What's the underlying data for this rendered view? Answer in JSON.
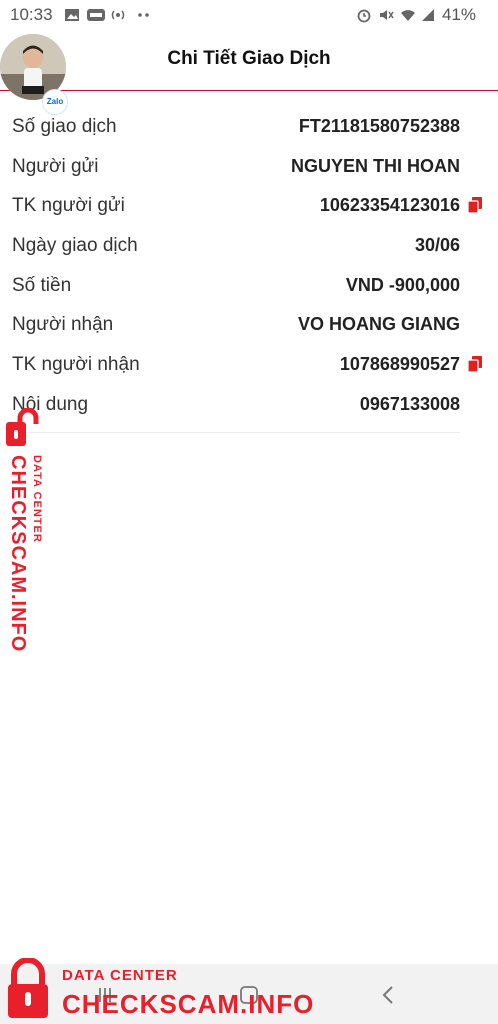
{
  "status_bar": {
    "time": "10:33",
    "battery": "41%",
    "icons": [
      "image-icon",
      "zalo-notification-icon",
      "hotspot-icon",
      "more-dots-icon",
      "alarm-icon",
      "mute-icon",
      "wifi-icon",
      "signal-icon"
    ]
  },
  "header": {
    "title": "Chi Tiết Giao Dịch",
    "avatar_badge": "Zalo"
  },
  "details": [
    {
      "label": "Số giao dịch",
      "value": "FT21181580752388",
      "copy": false
    },
    {
      "label": "Người gửi",
      "value": "NGUYEN THI HOAN",
      "copy": false
    },
    {
      "label": "TK người gửi",
      "value": "10623354123016",
      "copy": true
    },
    {
      "label": "Ngày giao dịch",
      "value": "30/06",
      "copy": false
    },
    {
      "label": "Số tiền",
      "value": "VND -900,000",
      "copy": false
    },
    {
      "label": "Người nhận",
      "value": "VO HOANG GIANG",
      "copy": false
    },
    {
      "label": "TK người nhận",
      "value": "107868990527",
      "copy": true
    },
    {
      "label": "Nội dung",
      "value": "0967133008",
      "copy": false
    }
  ],
  "watermark": {
    "main": "CHECKSCAM.INFO",
    "sub": "DATA CENTER",
    "color": "#e8202b"
  },
  "colors": {
    "accent_red": "#c8102e",
    "copy_icon": "#e02020"
  },
  "nav_bar": {
    "buttons": [
      "recent-apps-icon",
      "home-icon",
      "back-icon"
    ]
  }
}
